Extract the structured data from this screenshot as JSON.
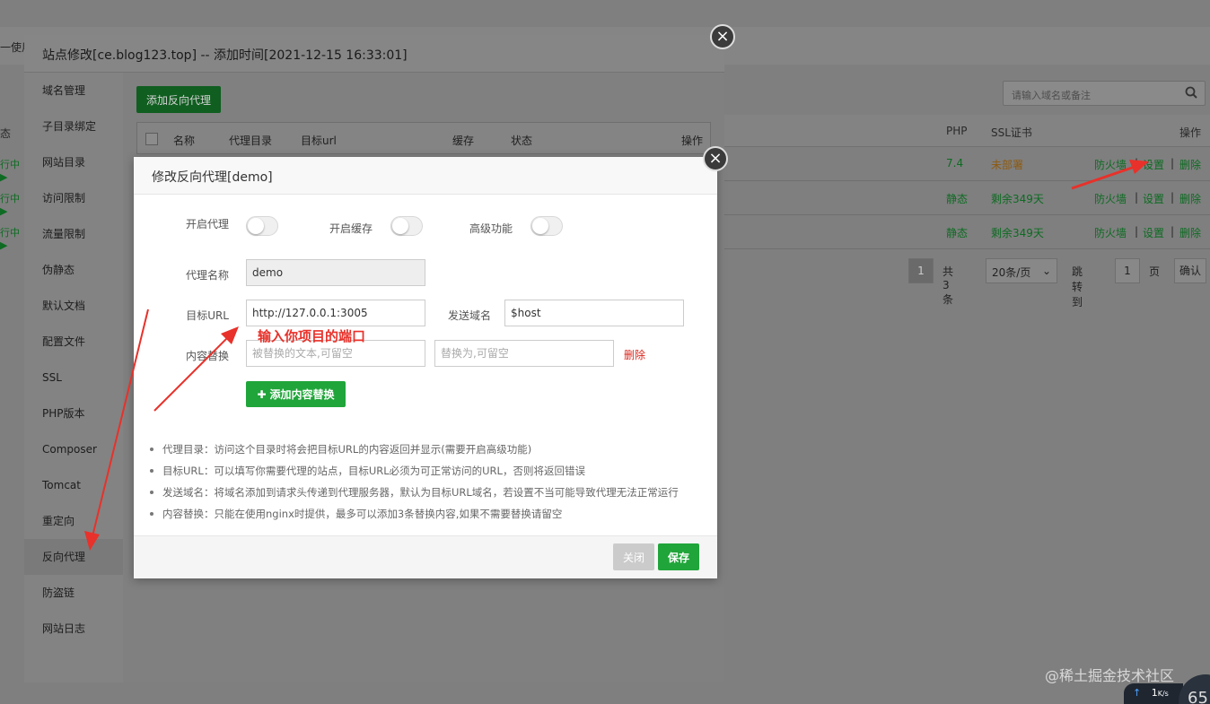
{
  "background": {
    "top_text": "一使用",
    "search_placeholder": "请输入域名或备注",
    "table_headers": {
      "php": "PHP",
      "ssl": "SSL证书",
      "ops": "操作"
    },
    "left_header": "态",
    "rows": [
      {
        "status": "行中▶",
        "php": "7.4",
        "ssl": "未部署",
        "firewall": "防火墙",
        "settings": "设置",
        "delete": "删除"
      },
      {
        "status": "行中▶",
        "php": "静态",
        "ssl": "剩余349天",
        "firewall": "防火墙",
        "settings": "设置",
        "delete": "删除"
      },
      {
        "status": "行中▶",
        "php": "静态",
        "ssl": "剩余349天",
        "firewall": "防火墙",
        "settings": "设置",
        "delete": "删除"
      }
    ],
    "separator": "|",
    "pager": {
      "current": "1",
      "total": "共3条",
      "per_page": "20条/页",
      "jump_label": "跳转到",
      "jump_value": "1",
      "page_unit": "页",
      "confirm": "确认"
    }
  },
  "outer_modal": {
    "title": "站点修改[ce.blog123.top] -- 添加时间[2021-12-15 16:33:01]",
    "sidebar": [
      "域名管理",
      "子目录绑定",
      "网站目录",
      "访问限制",
      "流量限制",
      "伪静态",
      "默认文档",
      "配置文件",
      "SSL",
      "PHP版本",
      "Composer",
      "Tomcat",
      "重定向",
      "反向代理",
      "防盗链",
      "网站日志"
    ],
    "active_item": "反向代理",
    "add_button": "添加反向代理",
    "table_headers": {
      "name": "名称",
      "dir": "代理目录",
      "target": "目标url",
      "cache": "缓存",
      "status": "状态",
      "ops": "操作"
    }
  },
  "inner_modal": {
    "title": "修改反向代理[demo]",
    "toggles": {
      "proxy": "开启代理",
      "cache": "开启缓存",
      "advanced": "高级功能"
    },
    "proxy_name_label": "代理名称",
    "proxy_name_value": "demo",
    "target_url_label": "目标URL",
    "target_url_value": "http://127.0.0.1:3005",
    "send_domain_label": "发送域名",
    "send_domain_value": "$host",
    "content_replace_label": "内容替换",
    "replace_from_placeholder": "被替换的文本,可留空",
    "replace_to_placeholder": "替换为,可留空",
    "delete_label": "删除",
    "add_replace_button": "添加内容替换",
    "tips": [
      "代理目录：访问这个目录时将会把目标URL的内容返回并显示(需要开启高级功能)",
      "目标URL：可以填写你需要代理的站点，目标URL必须为可正常访问的URL，否则将返回错误",
      "发送域名：将域名添加到请求头传递到代理服务器，默认为目标URL域名，若设置不当可能导致代理无法正常运行",
      "内容替换：只能在使用nginx时提供，最多可以添加3条替换内容,如果不需要替换请留空"
    ],
    "close_button": "关闭",
    "save_button": "保存"
  },
  "annotation": "输入你项目的端口",
  "watermark": "@稀土掘金技术社区",
  "speed": {
    "value": "1",
    "unit": "K/s",
    "gauge": "65"
  },
  "colors": {
    "accent_green": "#20a53a",
    "annotation_red": "#e8312a",
    "delete_red": "#d9261c"
  }
}
